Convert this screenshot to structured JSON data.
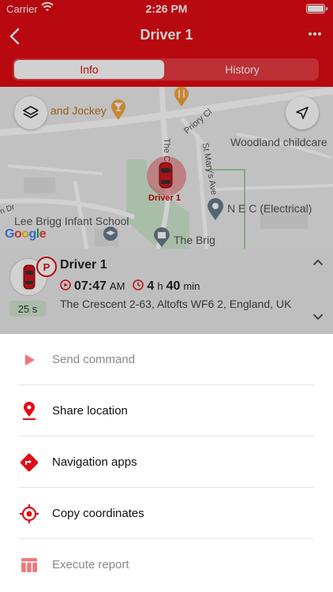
{
  "status_bar": {
    "carrier": "Carrier",
    "time": "2:26 PM"
  },
  "header": {
    "title": "Driver 1"
  },
  "tabs": [
    {
      "label": "Info",
      "selected": true
    },
    {
      "label": "History",
      "selected": false
    }
  ],
  "map": {
    "labels": {
      "pub": "and Jockey",
      "road1": "Priory Cl",
      "road2": "The C",
      "road3": "St Mary's Ave",
      "childcare": "Woodland childcare",
      "nec": "N E C (Electrical)",
      "dr": "n Dr",
      "school": "Lee Brigg Infant School",
      "brig": "The Brig"
    },
    "marker_label": "Driver 1",
    "google": [
      "G",
      "o",
      "o",
      "g",
      "l",
      "e"
    ],
    "google_colors": [
      "#4285F4",
      "#EA4335",
      "#FBBC05",
      "#4285F4",
      "#34A853",
      "#EA4335"
    ]
  },
  "card": {
    "name": "Driver 1",
    "status_badge": "P",
    "elapsed": "25 s",
    "start_time": "07:47",
    "start_ampm": "AM",
    "duration_h": "4",
    "duration_h_unit": "h",
    "duration_m": "40",
    "duration_m_unit": "min",
    "address": "The Crescent 2-63, Altofts WF6 2, England, UK"
  },
  "actions": [
    {
      "label": "Send command",
      "enabled": false,
      "icon": "play-icon"
    },
    {
      "label": "Share location",
      "enabled": true,
      "icon": "location-pin-icon"
    },
    {
      "label": "Navigation apps",
      "enabled": true,
      "icon": "directions-icon"
    },
    {
      "label": "Copy coordinates",
      "enabled": true,
      "icon": "crosshair-icon"
    },
    {
      "label": "Execute report",
      "enabled": false,
      "icon": "report-table-icon"
    }
  ],
  "colors": {
    "brand_red": "#e00b13",
    "sheet_bg": "#ffffff",
    "card_bg": "#e9e9e9"
  }
}
